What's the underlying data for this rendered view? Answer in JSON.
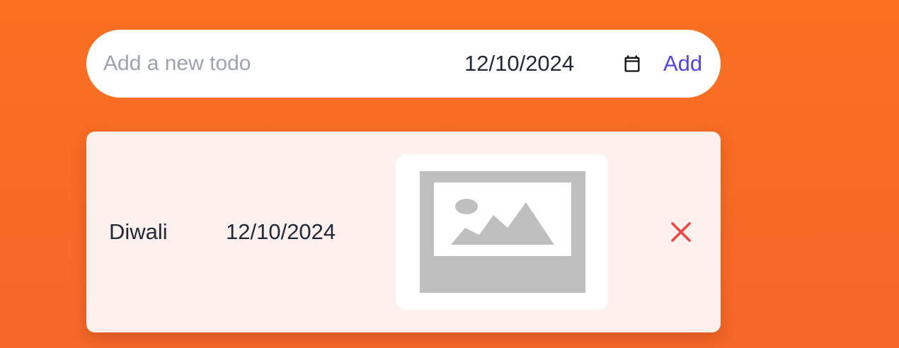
{
  "new_todo": {
    "placeholder": "Add a new todo",
    "value": "",
    "date": "12/10/2024",
    "calendar_icon": "calendar-icon",
    "add_label": "Add"
  },
  "todos": [
    {
      "title": "Diwali",
      "date": "12/10/2024",
      "image_icon": "image-placeholder-icon",
      "delete_icon": "close-icon"
    }
  ],
  "colors": {
    "background": "#f97020",
    "accent": "#4f46e5",
    "delete": "#ef4444",
    "card": "#fef0ec"
  }
}
